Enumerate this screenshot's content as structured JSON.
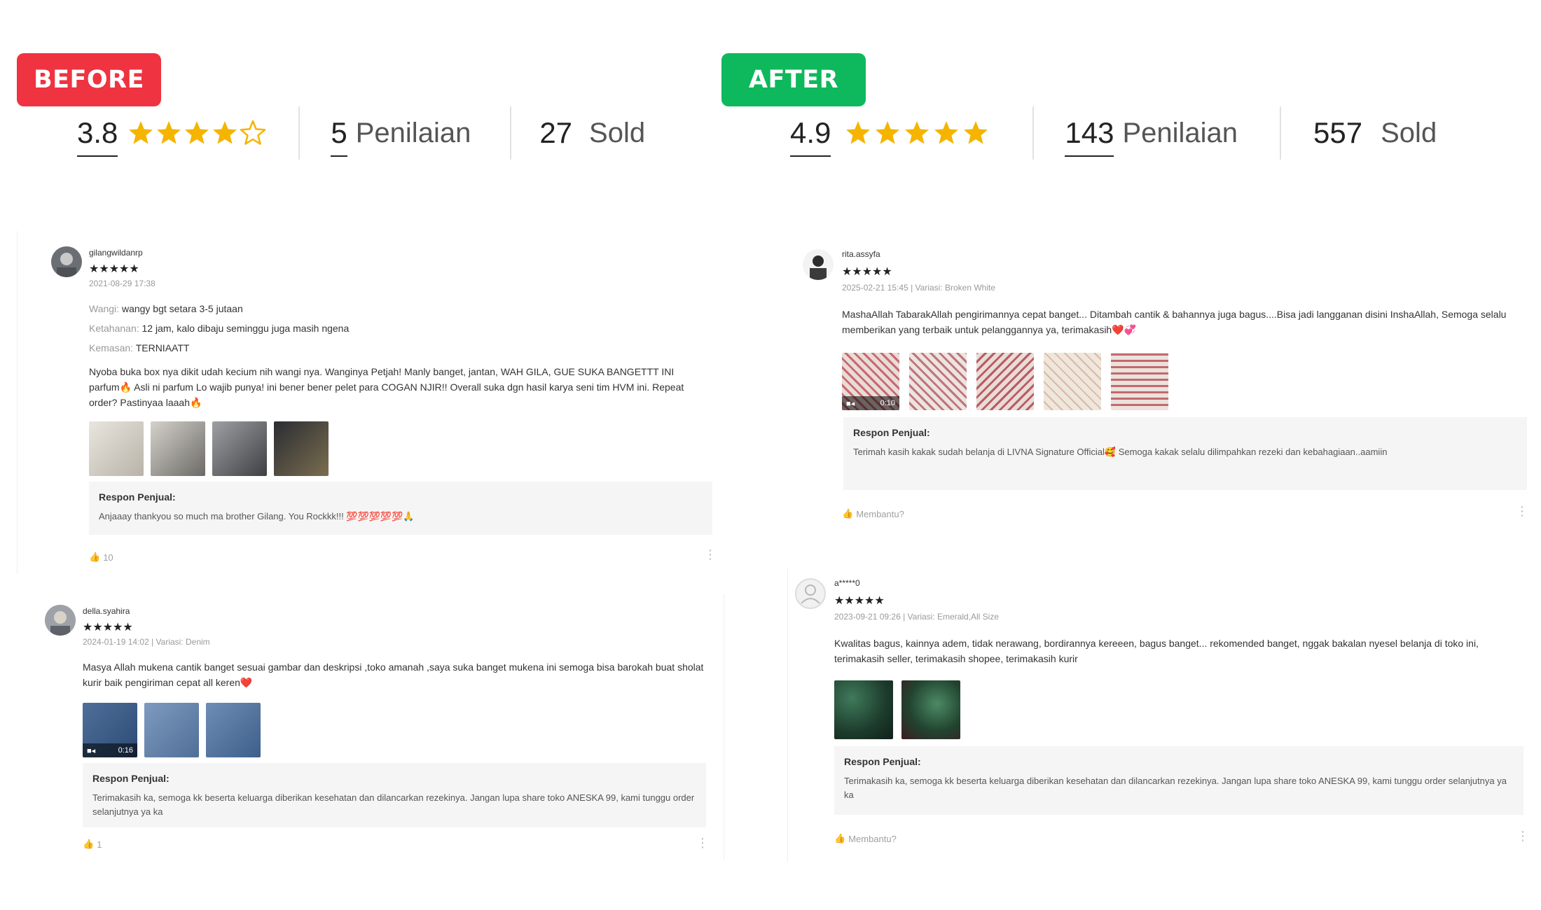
{
  "before": {
    "badge": "BEFORE",
    "rating": "3.8",
    "rating_stars": 3.8,
    "count_num": "5",
    "count_label": "Penilaian",
    "sold_num": "27",
    "sold_label": "Sold"
  },
  "after": {
    "badge": "AFTER",
    "rating": "4.9",
    "rating_stars": 4.9,
    "count_num": "143",
    "count_label": "Penilaian",
    "sold_num": "557",
    "sold_label": "Sold"
  },
  "reviews": [
    {
      "username": "gilangwildanrp",
      "stars": "★★★★★",
      "meta": "2021-08-29 17:38",
      "fields": [
        {
          "key": "Wangi:",
          "value": "wangy bgt setara 3-5 jutaan"
        },
        {
          "key": "Ketahanan:",
          "value": "12 jam, kalo dibaju seminggu juga masih ngena"
        },
        {
          "key": "Kemasan:",
          "value": "TERNIAATT"
        }
      ],
      "text": "Nyoba buka box nya dikit udah kecium nih wangi nya. Wanginya Petjah! Manly banget, jantan, WAH GILA, GUE SUKA BANGETTT INI parfum🔥 Asli ni parfum Lo wajib punya! ini bener bener pelet para COGAN NJIR!! Overall suka dgn hasil karya seni tim HVM ini. Repeat order? Pastinyaa laaah🔥",
      "response_title": "Respon Penjual:",
      "response": "Anjaaay thankyou so much ma brother Gilang. You Rockkk!!! 💯💯💯💯💯🙏",
      "likes": "10"
    },
    {
      "username": "della.syahira",
      "stars": "★★★★★",
      "meta": "2024-01-19 14:02 | Variasi: Denim",
      "text": "Masya Allah mukena cantik banget sesuai gambar dan deskripsi ,toko amanah ,saya suka banget mukena ini semoga bisa barokah buat sholat kurir baik pengiriman cepat all keren❤️",
      "video_time": "0:16",
      "response_title": "Respon Penjual:",
      "response": "Terimakasih ka, semoga kk beserta keluarga diberikan kesehatan dan dilancarkan rezekinya. Jangan lupa share toko ANESKA 99, kami tunggu order selanjutnya ya ka",
      "likes": "1"
    },
    {
      "username": "rita.assyfa",
      "stars": "★★★★★",
      "meta": "2025-02-21 15:45 | Variasi: Broken White",
      "text": "MashaAllah TabarakAllah pengirimannya cepat banget... Ditambah cantik & bahannya juga bagus....Bisa jadi langganan disini InshaAllah, Semoga selalu memberikan yang terbaik untuk pelanggannya ya, terimakasih❤️💞",
      "video_time": "0:10",
      "response_title": "Respon Penjual:",
      "response": "Terimah kasih kakak sudah belanja di LIVNA Signature Official🥰 Semoga kakak selalu dilimpahkan rezeki dan kebahagiaan..aamiin",
      "likes": "Membantu?"
    },
    {
      "username": "a*****0",
      "stars": "★★★★★",
      "meta": "2023-09-21 09:26 | Variasi: Emerald,All Size",
      "text": "Kwalitas bagus, kainnya adem, tidak nerawang,  bordirannya kereeen,  bagus banget... rekomended banget, nggak bakalan nyesel belanja di toko ini, terimakasih seller, terimakasih shopee, terimakasih kurir",
      "response_title": "Respon Penjual:",
      "response": "Terimakasih ka, semoga kk beserta keluarga diberikan kesehatan dan dilancarkan rezekinya. Jangan lupa share toko ANESKA 99, kami tunggu order selanjutnya ya ka",
      "likes": "Membantu?"
    }
  ],
  "colors": {
    "before_badge": "#ef3340",
    "after_badge": "#0eb85c",
    "star": "#f5b400",
    "review_star": "#e8302b"
  }
}
